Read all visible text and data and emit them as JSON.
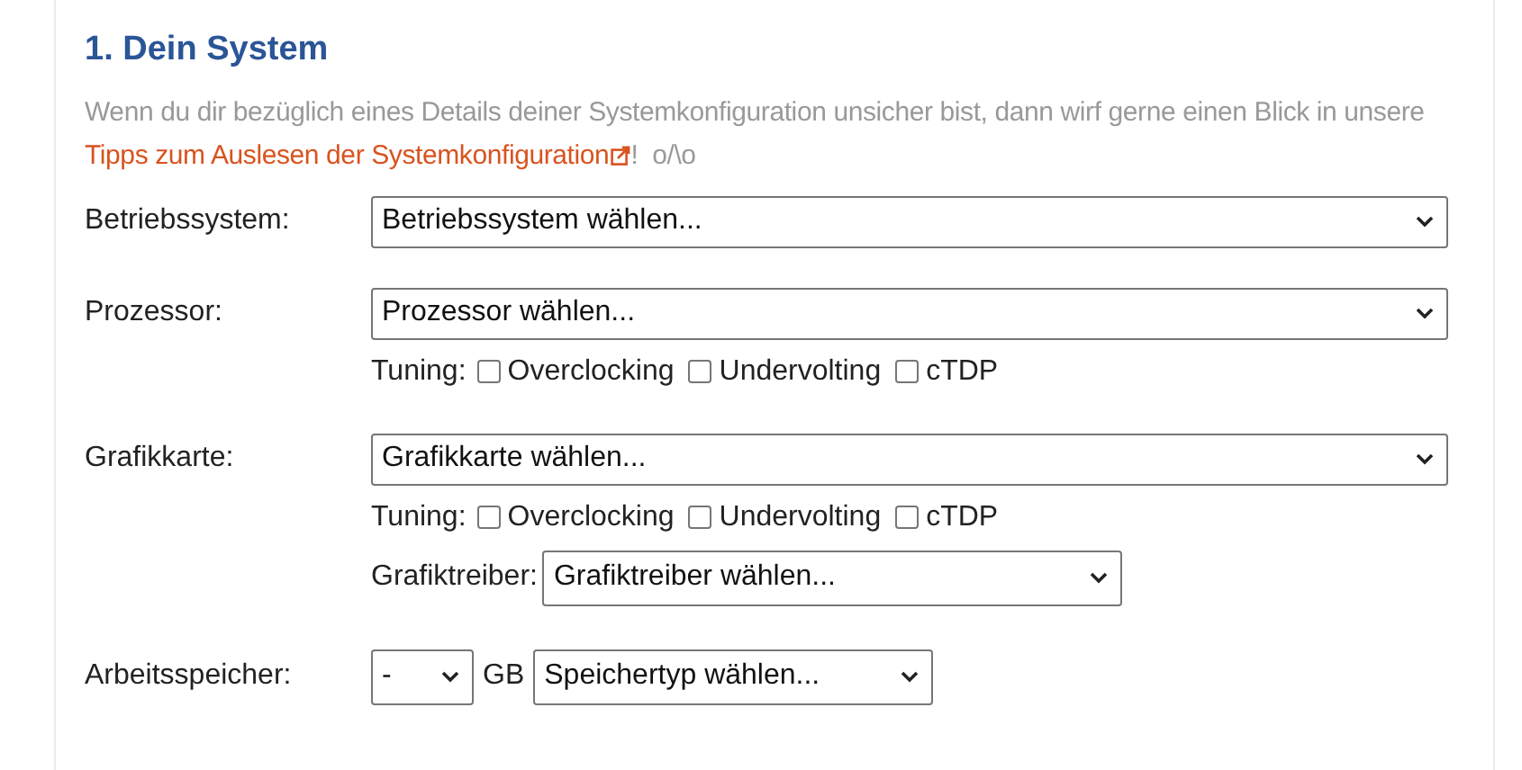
{
  "heading": "1. Dein System",
  "intro": {
    "before": "Wenn du dir bezüglich eines Details deiner Systemkonfiguration unsicher bist, dann wirf gerne einen Blick in unsere ",
    "link": "Tipps zum Auslesen der Systemkonfiguration",
    "after": "!  o/\\o"
  },
  "rows": [
    {
      "kind": "select",
      "label": "Betriebssystem:",
      "select": "Betriebssystem wählen..."
    },
    {
      "kind": "select",
      "label": "Prozessor:",
      "select": "Prozessor wählen...",
      "tuning": {
        "label": "Tuning:",
        "options": [
          {
            "label": "Overclocking",
            "checked": false
          },
          {
            "label": "Undervolting",
            "checked": false
          },
          {
            "label": "cTDP",
            "checked": false
          }
        ]
      }
    },
    {
      "kind": "select",
      "label": "Grafikkarte:",
      "select": "Grafikkarte wählen...",
      "tuning": {
        "label": "Tuning:",
        "options": [
          {
            "label": "Overclocking",
            "checked": false
          },
          {
            "label": "Undervolting",
            "checked": false
          },
          {
            "label": "cTDP",
            "checked": false
          }
        ]
      },
      "driver": {
        "label": "Grafiktreiber:",
        "select": "Grafiktreiber wählen..."
      }
    },
    {
      "kind": "memory",
      "label": "Arbeitsspeicher:",
      "amount": "-",
      "unit": "GB",
      "select": "Speichertyp wählen..."
    }
  ]
}
